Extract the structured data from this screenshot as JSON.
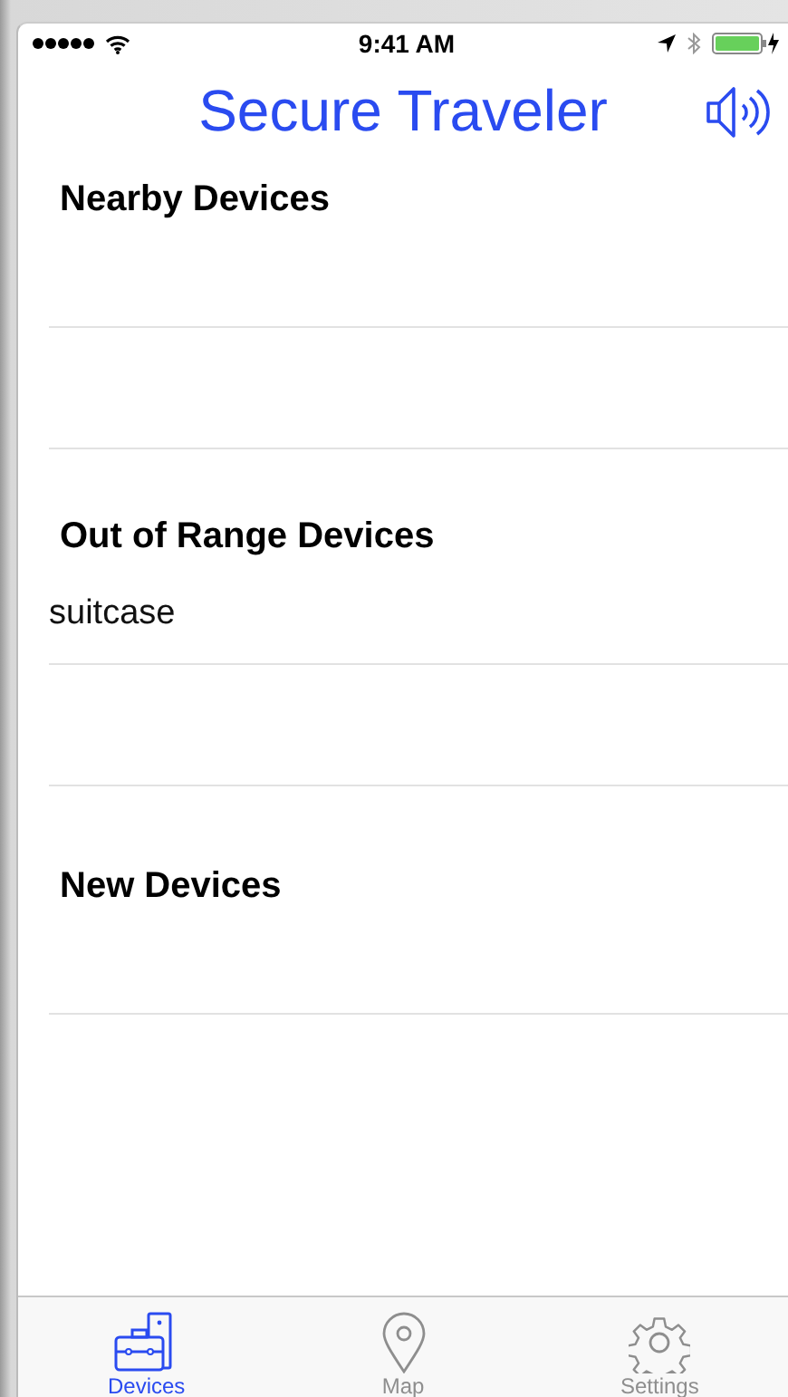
{
  "status_bar": {
    "time": "9:41 AM"
  },
  "header": {
    "title": "Secure Traveler"
  },
  "sections": [
    {
      "title": "Nearby Devices"
    },
    {
      "title": "Out of Range Devices",
      "devices": [
        {
          "name": "suitcase"
        }
      ]
    },
    {
      "title": "New Devices"
    }
  ],
  "tabs": [
    {
      "label": "Devices",
      "kind": "devices",
      "selected": true
    },
    {
      "label": "Map",
      "kind": "map",
      "selected": false
    },
    {
      "label": "Settings",
      "kind": "settings",
      "selected": false
    }
  ]
}
